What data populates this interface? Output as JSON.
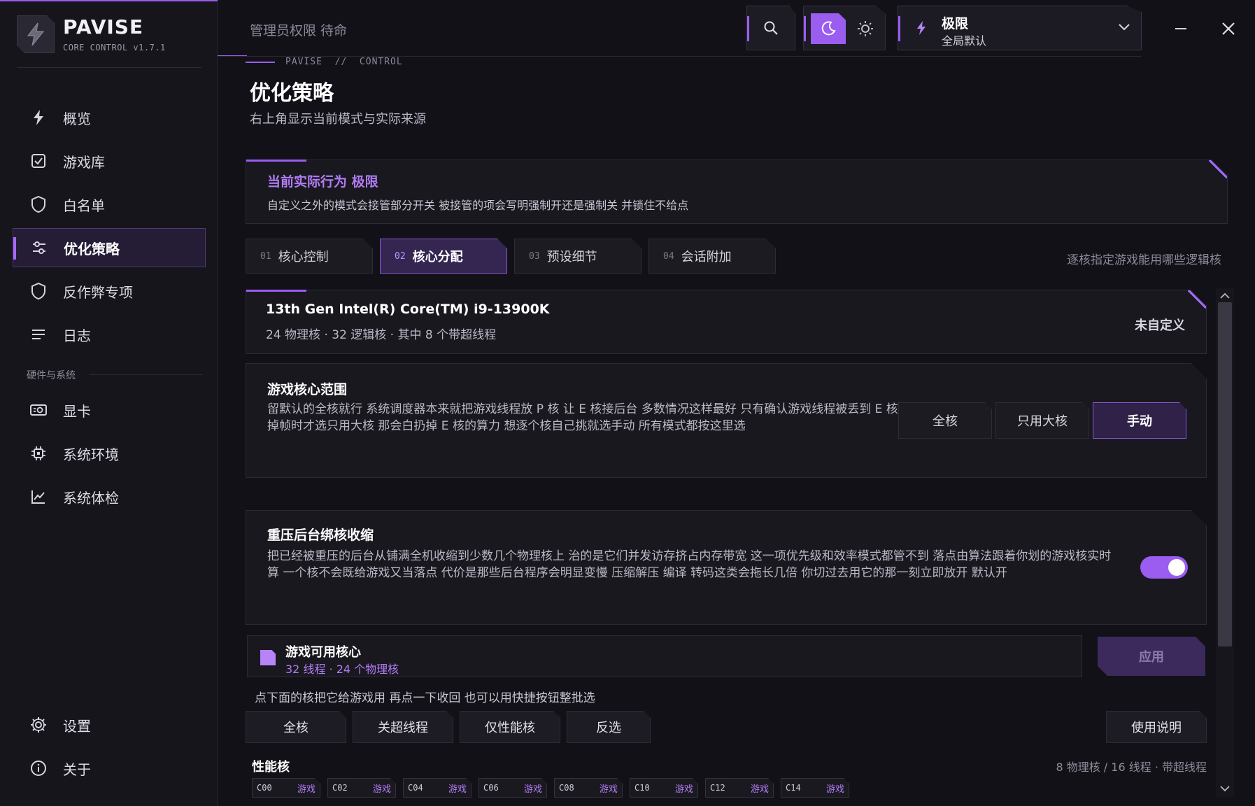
{
  "brand": {
    "name": "PAVISE",
    "version": "CORE CONTROL v1.7.1"
  },
  "sidebar": {
    "items": [
      {
        "label": "概览",
        "icon": "bolt-icon"
      },
      {
        "label": "游戏库",
        "icon": "checkbox-icon"
      },
      {
        "label": "白名单",
        "icon": "shield-icon"
      },
      {
        "label": "优化策略",
        "icon": "sliders-icon",
        "active": true
      },
      {
        "label": "反作弊专项",
        "icon": "shield-icon"
      },
      {
        "label": "日志",
        "icon": "list-icon"
      }
    ],
    "section_label": "硬件与系统",
    "hw_items": [
      {
        "label": "显卡",
        "icon": "gpu-icon"
      },
      {
        "label": "系统环境",
        "icon": "chip-icon"
      },
      {
        "label": "系统体检",
        "icon": "chart-icon"
      }
    ],
    "bottom_items": [
      {
        "label": "设置",
        "icon": "gear-icon"
      },
      {
        "label": "关于",
        "icon": "info-icon"
      }
    ]
  },
  "topbar": {
    "admin_status": "管理员权限 待命",
    "mode_title": "极限",
    "mode_sub": "全局默认"
  },
  "page": {
    "breadcrumb": "PAVISE  //  CONTROL",
    "title": "优化策略",
    "subtitle": "右上角显示当前模式与实际来源"
  },
  "notice": {
    "title": "当前实际行为 极限",
    "body": "自定义之外的模式会接管部分开关 被接管的项会写明强制开还是强制关 并锁住不给点"
  },
  "tabs": [
    {
      "num": "01",
      "label": "核心控制"
    },
    {
      "num": "02",
      "label": "核心分配",
      "active": true
    },
    {
      "num": "03",
      "label": "预设细节"
    },
    {
      "num": "04",
      "label": "会话附加"
    }
  ],
  "tabs_hint": "逐核指定游戏能用哪些逻辑核",
  "cpu": {
    "name": "13th Gen Intel(R) Core(TM) i9-13900K",
    "spec": "24 物理核 · 32 逻辑核 · 其中 8 个带超线程",
    "status": "未自定义"
  },
  "core_range": {
    "title": "游戏核心范围",
    "desc": "留默认的全核就行 系统调度器本来就把游戏线程放 P 核 让 E 核接后台 多数情况这样最好 只有确认游戏线程被丢到 E 核掉帧时才选只用大核 那会白扔掉 E 核的算力 想逐个核自己挑就选手动 所有模式都按这里选",
    "options": [
      "全核",
      "只用大核",
      "手动"
    ],
    "selected": 2
  },
  "bg_bind": {
    "title": "重压后台绑核收缩",
    "desc": "把已经被重压的后台从铺满全机收缩到少数几个物理核上 治的是它们并发访存挤占内存带宽 这一项优先级和效率模式都管不到 落点由算法跟着你划的游戏核实时算 一个核不会既给游戏又当落点 代价是那些后台程序会明显变慢 压缩解压 编译 转码这类会拖长几倍 你切过去用它的那一刻立即放开 默认开",
    "enabled": true
  },
  "available": {
    "title": "游戏可用核心",
    "summary": "32 线程 · 24 个物理核",
    "apply": "应用",
    "hint": "点下面的核把它给游戏用 再点一下收回 也可以用快捷按钮整批选",
    "quick": [
      "全核",
      "关超线程",
      "仅性能核",
      "反选"
    ],
    "help": "使用说明"
  },
  "perf_cores": {
    "title": "性能核",
    "summary": "8 物理核 / 16 线程 · 带超线程",
    "cores": [
      {
        "id": "C00",
        "tag": "游戏"
      },
      {
        "id": "C02",
        "tag": "游戏"
      },
      {
        "id": "C04",
        "tag": "游戏"
      },
      {
        "id": "C06",
        "tag": "游戏"
      },
      {
        "id": "C08",
        "tag": "游戏"
      },
      {
        "id": "C10",
        "tag": "游戏"
      },
      {
        "id": "C12",
        "tag": "游戏"
      },
      {
        "id": "C14",
        "tag": "游戏"
      }
    ]
  },
  "colors": {
    "accent": "#9b5cf0",
    "bg": "#121118",
    "panel": "#19181f"
  }
}
